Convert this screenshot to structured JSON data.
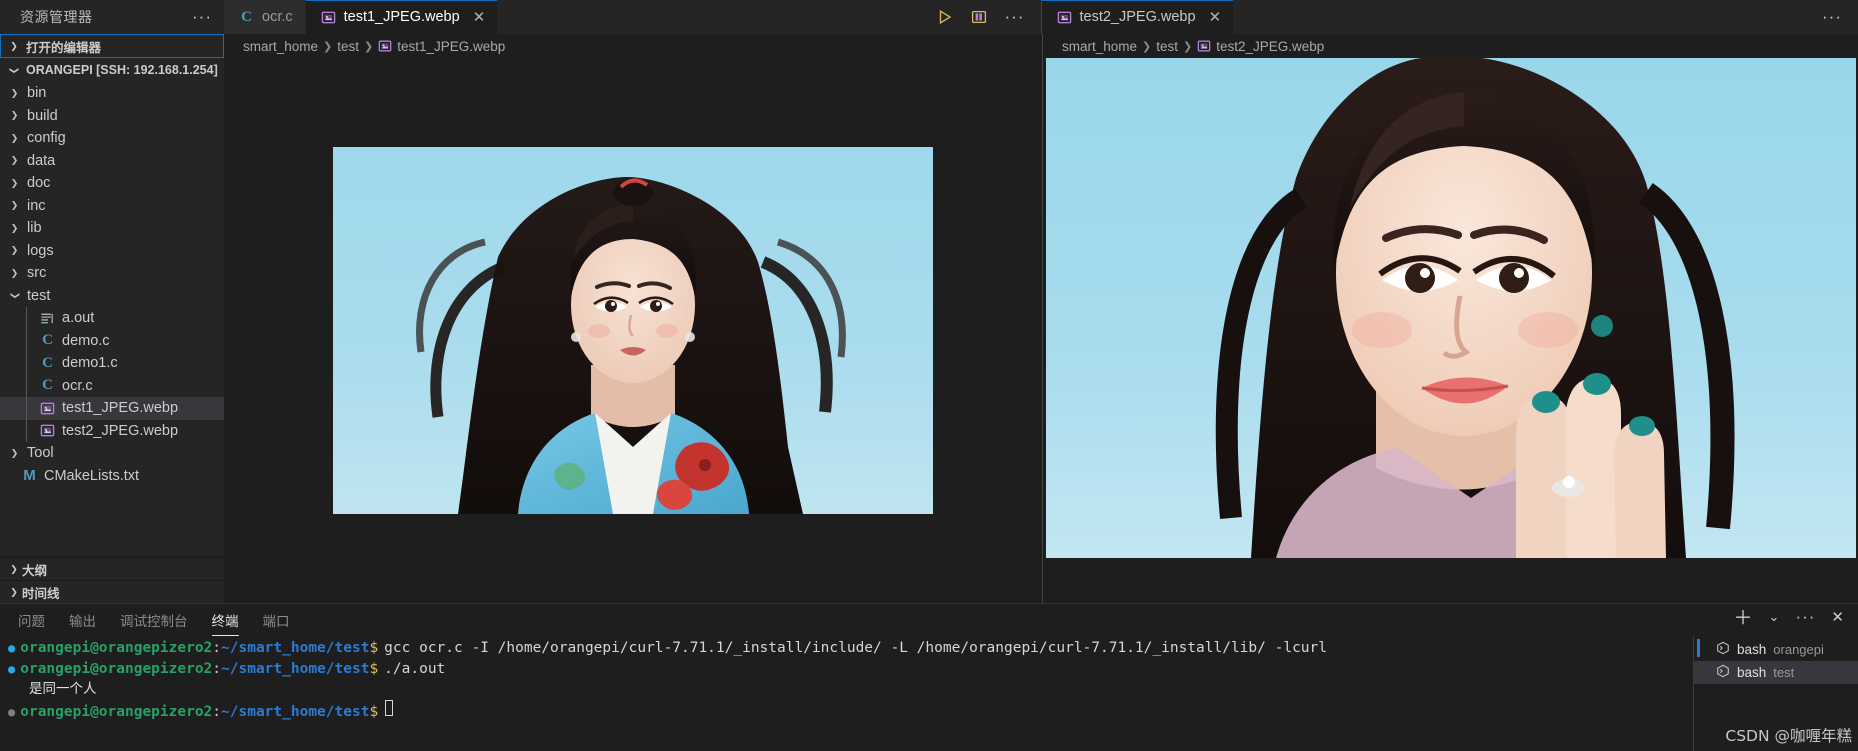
{
  "window": {
    "theme_bg": "#1e1e1e",
    "accent": "#0f6fc5"
  },
  "sidebar": {
    "title": "资源管理器",
    "more_label": "···",
    "open_editors_label": "打开的编辑器",
    "root_label": "ORANGEPI [SSH: 192.168.1.254]",
    "tree": [
      {
        "label": "bin",
        "type": "folder",
        "expanded": false,
        "depth": 1
      },
      {
        "label": "build",
        "type": "folder",
        "expanded": false,
        "depth": 1
      },
      {
        "label": "config",
        "type": "folder",
        "expanded": false,
        "depth": 1
      },
      {
        "label": "data",
        "type": "folder",
        "expanded": false,
        "depth": 1
      },
      {
        "label": "doc",
        "type": "folder",
        "expanded": false,
        "depth": 1
      },
      {
        "label": "inc",
        "type": "folder",
        "expanded": false,
        "depth": 1
      },
      {
        "label": "lib",
        "type": "folder",
        "expanded": false,
        "depth": 1
      },
      {
        "label": "logs",
        "type": "folder",
        "expanded": false,
        "depth": 1
      },
      {
        "label": "src",
        "type": "folder",
        "expanded": false,
        "depth": 1
      },
      {
        "label": "test",
        "type": "folder",
        "expanded": true,
        "depth": 1
      },
      {
        "label": "a.out",
        "type": "binary",
        "depth": 2
      },
      {
        "label": "demo.c",
        "type": "c",
        "depth": 2
      },
      {
        "label": "demo1.c",
        "type": "c",
        "depth": 2
      },
      {
        "label": "ocr.c",
        "type": "c",
        "depth": 2
      },
      {
        "label": "test1_JPEG.webp",
        "type": "image",
        "depth": 2,
        "selected": true
      },
      {
        "label": "test2_JPEG.webp",
        "type": "image",
        "depth": 2
      },
      {
        "label": "Tool",
        "type": "folder",
        "expanded": false,
        "depth": 1
      },
      {
        "label": "CMakeLists.txt",
        "type": "cmake",
        "depth": 1
      }
    ],
    "sections": [
      {
        "label": "大纲"
      },
      {
        "label": "时间线"
      }
    ]
  },
  "editor_left": {
    "tabs": [
      {
        "label": "ocr.c",
        "icon": "c-file-icon",
        "active": false,
        "closable": false
      },
      {
        "label": "test1_JPEG.webp",
        "icon": "image-file-icon",
        "active": true,
        "closable": true,
        "close_label": "✕"
      }
    ],
    "actions": [
      {
        "name": "run-button",
        "label": "▷"
      },
      {
        "name": "split-editor-button",
        "label": "▥"
      },
      {
        "name": "more-actions-button",
        "label": "···"
      }
    ],
    "breadcrumb": [
      "smart_home",
      "test",
      "test1_JPEG.webp"
    ],
    "image_alt": "test1_JPEG.webp"
  },
  "editor_right": {
    "tabs": [
      {
        "label": "test2_JPEG.webp",
        "icon": "image-file-icon",
        "active": true,
        "closable": true,
        "close_label": "✕"
      }
    ],
    "more_label": "···",
    "breadcrumb": [
      "smart_home",
      "test",
      "test2_JPEG.webp"
    ],
    "image_alt": "test2_JPEG.webp"
  },
  "panel": {
    "tabs": [
      {
        "label": "问题",
        "active": false
      },
      {
        "label": "输出",
        "active": false
      },
      {
        "label": "调试控制台",
        "active": false
      },
      {
        "label": "终端",
        "active": true
      },
      {
        "label": "端口",
        "active": false
      }
    ],
    "actions": [
      {
        "name": "new-terminal-button",
        "label": "＋"
      },
      {
        "name": "terminal-dropdown",
        "label": "⌄"
      },
      {
        "name": "panel-more-button",
        "label": "···"
      },
      {
        "name": "close-panel-button",
        "label": "✕"
      }
    ],
    "terminal": {
      "prompt_user": "orangepi@orangepizero2",
      "prompt_path": "~/smart_home/test",
      "prompt_dollar": "$",
      "lines": [
        {
          "type": "command",
          "text": "gcc ocr.c -I /home/orangepi/curl-7.71.1/_install/include/ -L /home/orangepi/curl-7.71.1/_install/lib/ -lcurl"
        },
        {
          "type": "command",
          "text": "./a.out"
        },
        {
          "type": "output",
          "text": "是同一个人"
        },
        {
          "type": "prompt-only",
          "text": ""
        }
      ]
    },
    "terminal_list": [
      {
        "name": "bash",
        "detail": "orangepi",
        "selected": false
      },
      {
        "name": "bash",
        "detail": "test",
        "selected": true
      }
    ]
  },
  "watermark": {
    "text": "CSDN @咖喱年糕"
  }
}
